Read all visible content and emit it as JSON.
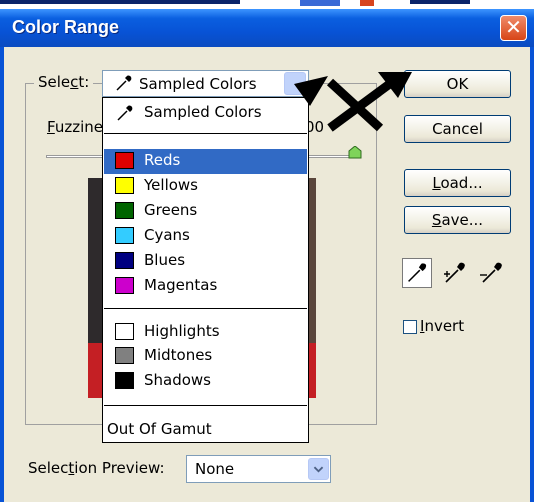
{
  "dialog": {
    "title": "Color Range",
    "close_glyph": "✕"
  },
  "select": {
    "label_pre": "Sele",
    "label_hot": "c",
    "label_post": "t:",
    "value": "Sampled Colors",
    "icon": "eyedropper-icon"
  },
  "fuzziness": {
    "label_hot": "F",
    "label_rest": "uzzine",
    "value_visible": "00"
  },
  "dropdown": {
    "items": [
      {
        "label": "Sampled Colors",
        "swatch": null,
        "icon": "eyedropper-icon"
      },
      {
        "label": "Reds",
        "swatch": "#e00000",
        "selected": true
      },
      {
        "label": "Yellows",
        "swatch": "#ffff00"
      },
      {
        "label": "Greens",
        "swatch": "#006400"
      },
      {
        "label": "Cyans",
        "swatch": "#33ccff"
      },
      {
        "label": "Blues",
        "swatch": "#000080"
      },
      {
        "label": "Magentas",
        "swatch": "#cc00cc"
      },
      {
        "label": "Highlights",
        "swatch": "#ffffff"
      },
      {
        "label": "Midtones",
        "swatch": "#808080"
      },
      {
        "label": "Shadows",
        "swatch": "#000000"
      },
      {
        "label": "Out Of Gamut",
        "swatch": null
      }
    ]
  },
  "buttons": {
    "ok": "OK",
    "cancel": "Cancel",
    "load_hot": "L",
    "load_rest": "oad...",
    "save_hot": "S",
    "save_rest": "ave..."
  },
  "invert": {
    "label_hot": "I",
    "label_rest": "nvert",
    "checked": false
  },
  "selection_preview": {
    "label_pre": "Selec",
    "label_hot": "t",
    "label_post": "ion Preview:",
    "value": "None"
  },
  "colors": {
    "titlebar": "#0853d6",
    "highlight": "#316ac5",
    "dialog_bg": "#ece9d8"
  }
}
